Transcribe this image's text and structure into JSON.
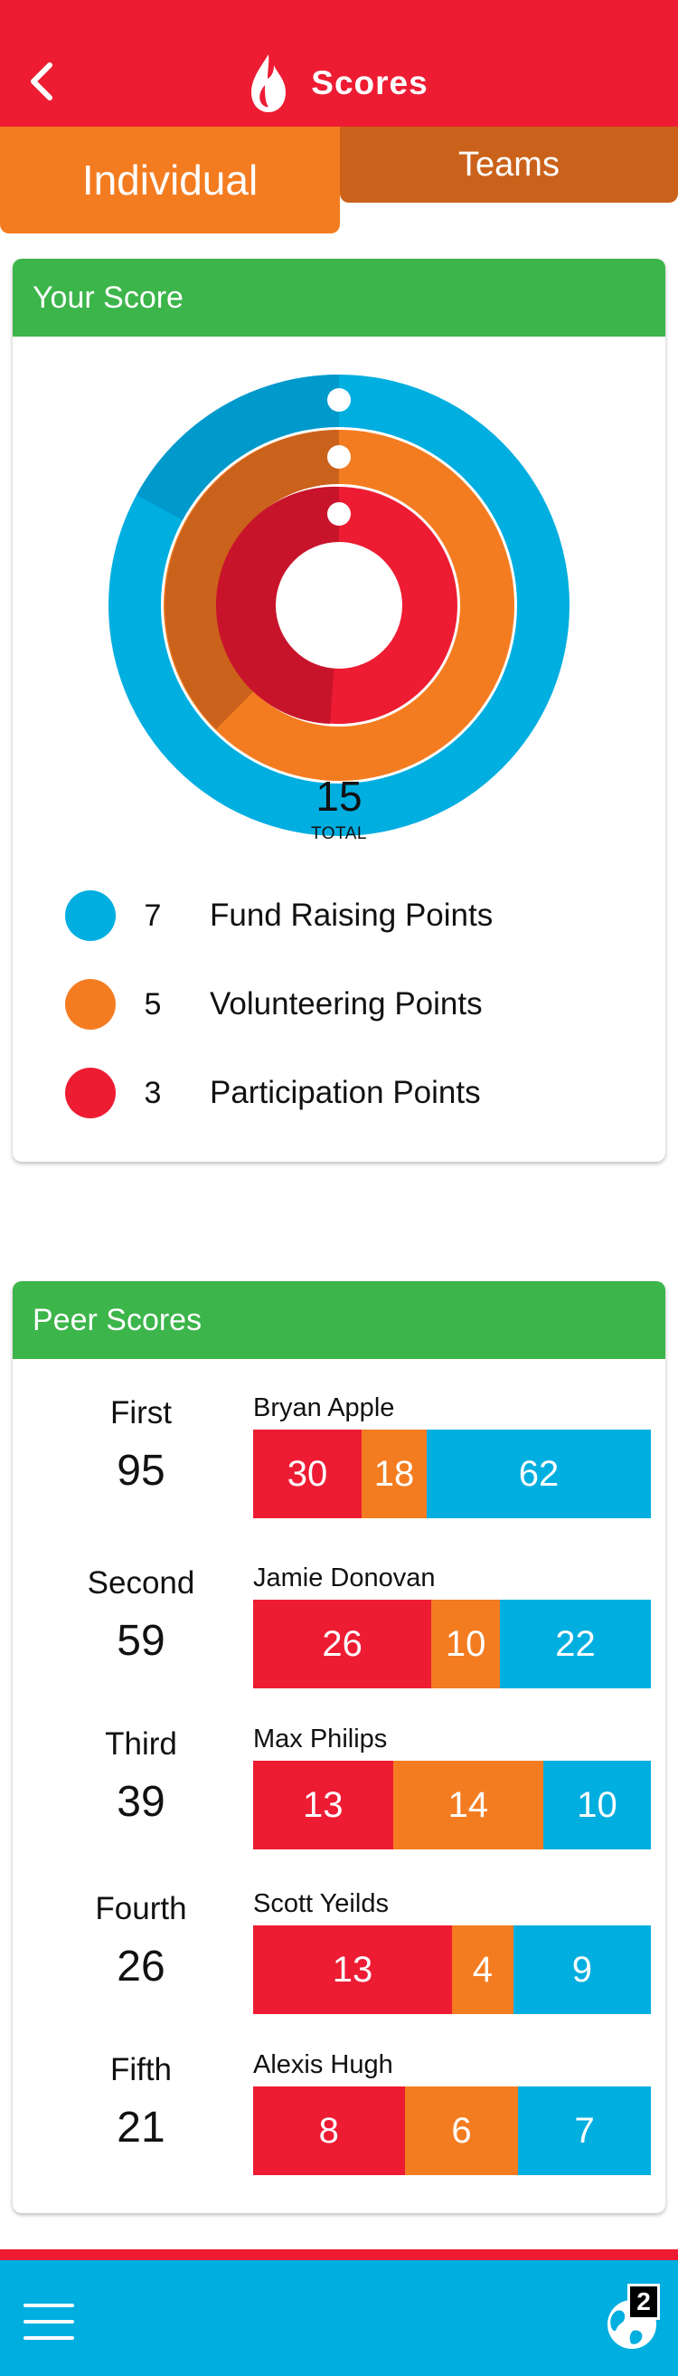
{
  "header": {
    "title": "Scores",
    "back_icon": "chevron-left-icon",
    "logo_icon": "flame-drop-icon",
    "background": "#ed1c33"
  },
  "tabs": {
    "individual": "Individual",
    "teams": "Teams"
  },
  "your_score": {
    "title": "Your Score",
    "total_value": "15",
    "total_label": "TOTAL",
    "categories": [
      {
        "value": "7",
        "label": "Fund Raising Points",
        "color": "#00aee0"
      },
      {
        "value": "5",
        "label": "Volunteering Points",
        "color": "#f47c20"
      },
      {
        "value": "3",
        "label": "Participation Points",
        "color": "#ed1c33"
      }
    ]
  },
  "peer_scores": {
    "title": "Peer Scores",
    "peers": [
      {
        "rank": "First",
        "score": "95",
        "name": "Bryan Apple",
        "participation": "30",
        "volunteering": "18",
        "fund_raising": "62"
      },
      {
        "rank": "Second",
        "score": "59",
        "name": "Jamie Donovan",
        "participation": "26",
        "volunteering": "10",
        "fund_raising": "22"
      },
      {
        "rank": "Third",
        "score": "39",
        "name": "Max Philips",
        "participation": "13",
        "volunteering": "14",
        "fund_raising": "10"
      },
      {
        "rank": "Fourth",
        "score": "26",
        "name": "Scott Yeilds",
        "participation": "13",
        "volunteering": "4",
        "fund_raising": "9"
      },
      {
        "rank": "Fifth",
        "score": "21",
        "name": "Alexis Hugh",
        "participation": "8",
        "volunteering": "6",
        "fund_raising": "7"
      }
    ]
  },
  "bottom_nav": {
    "menu_icon": "hamburger-menu-icon",
    "globe_icon": "globe-icon",
    "notification_count": "2"
  }
}
